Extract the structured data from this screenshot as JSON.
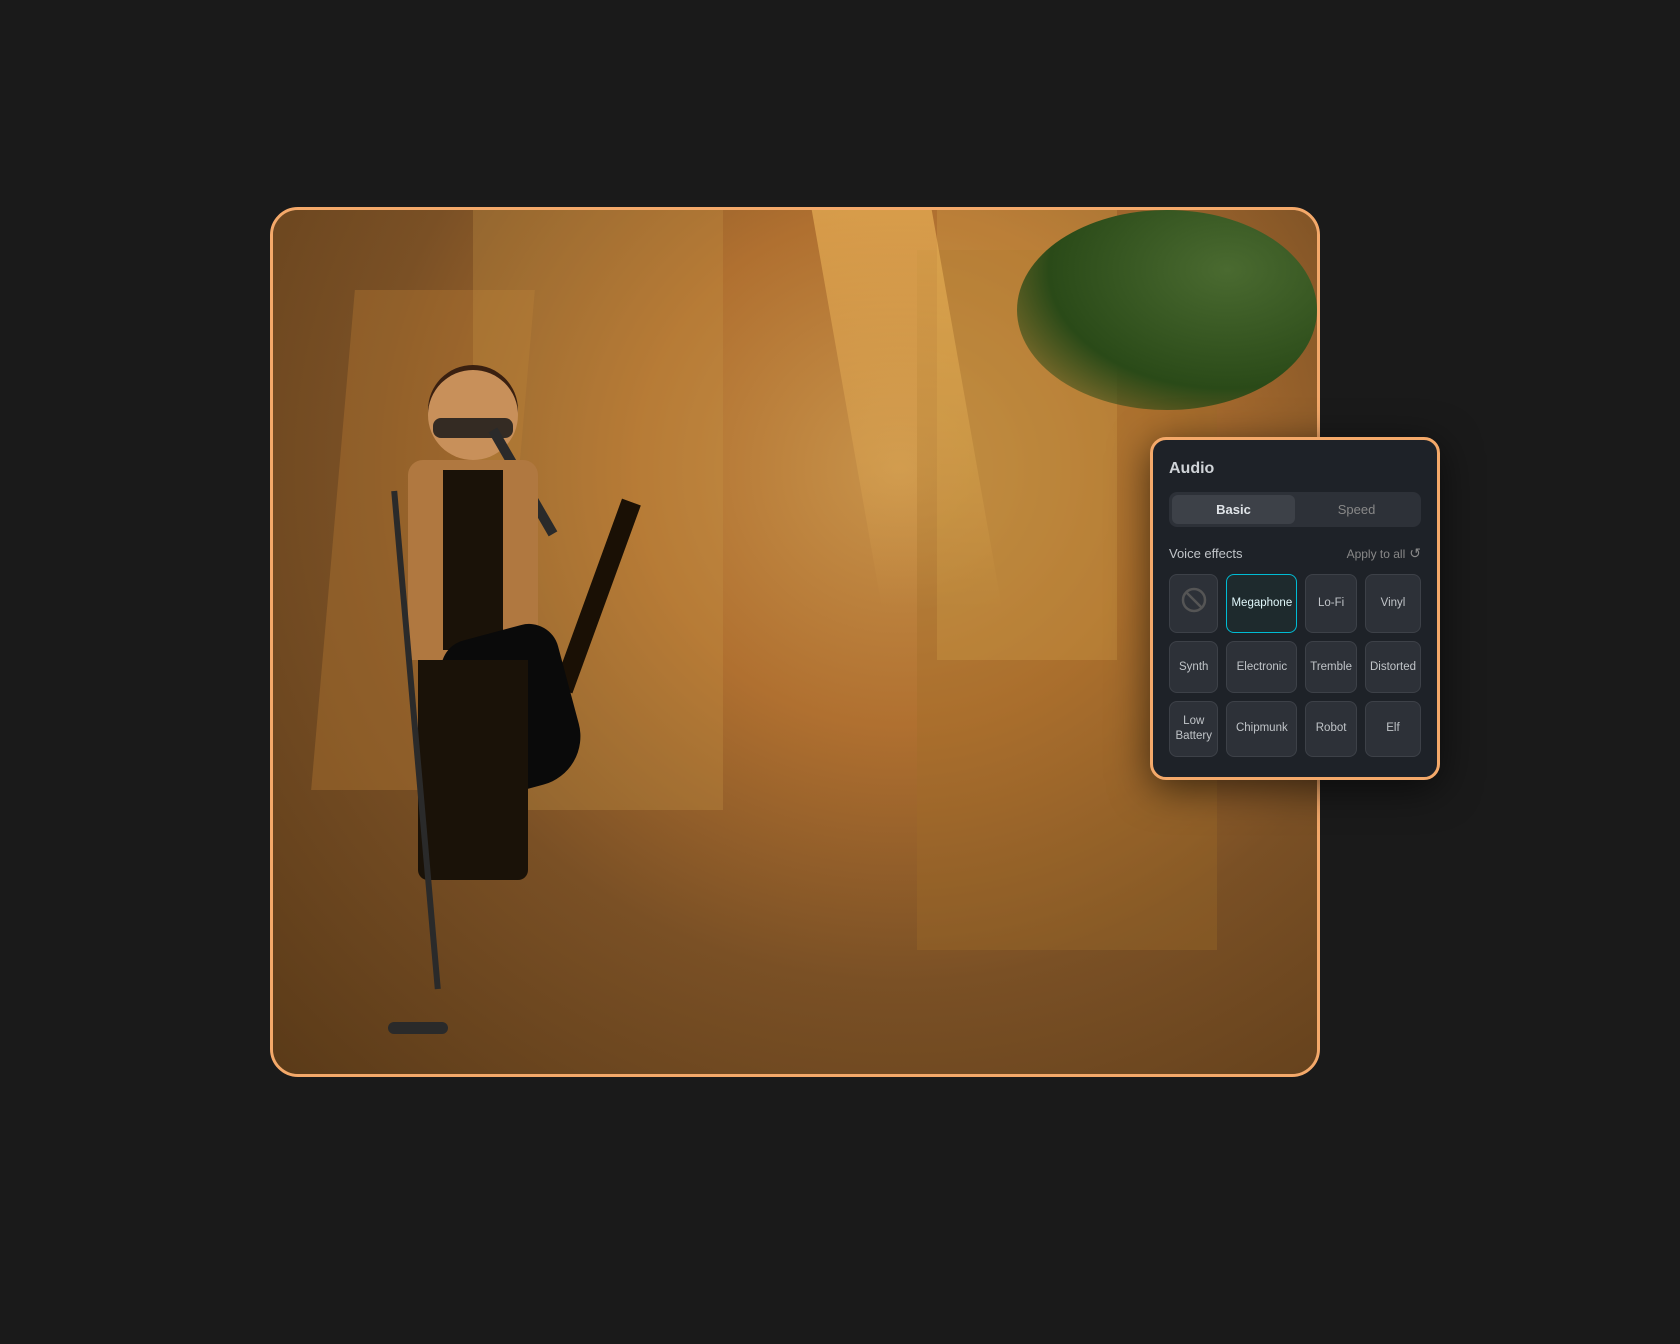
{
  "scene": {
    "panel": {
      "title": "Audio",
      "tabs": [
        {
          "id": "basic",
          "label": "Basic",
          "active": true
        },
        {
          "id": "speed",
          "label": "Speed",
          "active": false
        }
      ],
      "voice_effects_label": "Voice effects",
      "apply_to_all_label": "Apply to all",
      "effects": [
        {
          "id": "none",
          "label": "",
          "type": "none",
          "active": false
        },
        {
          "id": "megaphone",
          "label": "Megaphone",
          "active": true
        },
        {
          "id": "lofi",
          "label": "Lo-Fi",
          "active": false
        },
        {
          "id": "vinyl",
          "label": "Vinyl",
          "active": false
        },
        {
          "id": "synth",
          "label": "Synth",
          "active": false
        },
        {
          "id": "electronic",
          "label": "Electronic",
          "active": false
        },
        {
          "id": "tremble",
          "label": "Tremble",
          "active": false
        },
        {
          "id": "distorted",
          "label": "Distorted",
          "active": false
        },
        {
          "id": "low-battery",
          "label": "Low Battery",
          "active": false
        },
        {
          "id": "chipmunk",
          "label": "Chipmunk",
          "active": false
        },
        {
          "id": "robot",
          "label": "Robot",
          "active": false
        },
        {
          "id": "elf",
          "label": "Elf",
          "active": false
        }
      ]
    }
  }
}
